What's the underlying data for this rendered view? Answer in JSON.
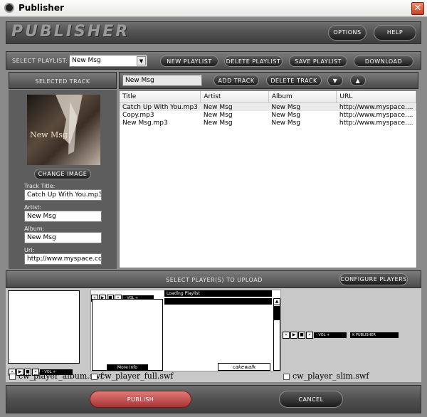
{
  "window": {
    "title": "Publisher",
    "close_symbol": "✕"
  },
  "header": {
    "logo": "PUBLISHER",
    "options_label": "OPTIONS",
    "help_label": "HELP"
  },
  "playlist_bar": {
    "select_label": "SELECT PLAYLIST:",
    "selected_value": "New Msg",
    "new_label": "NEW PLAYLIST",
    "delete_label": "DELETE PLAYLIST",
    "save_label": "SAVE PLAYLIST",
    "download_label": "DOWNLOAD"
  },
  "selected_track": {
    "header": "SELECTED TRACK",
    "cover_text": "New Msg",
    "change_image_label": "CHANGE IMAGE",
    "track_title_label": "Track Title:",
    "track_title_value": "Catch Up With You.mp3",
    "artist_label": "Artist:",
    "artist_value": "New Msg",
    "album_label": "Album:",
    "album_value": "New Msg",
    "url_label": "Url:",
    "url_value": "http://www.myspace.com/"
  },
  "playlist_toolbar": {
    "name_value": "New Msg",
    "add_track_label": "ADD TRACK",
    "delete_track_label": "DELETE TRACK",
    "move_down_symbol": "▼",
    "move_up_symbol": "▲"
  },
  "tracks_table": {
    "columns": [
      "Title",
      "Artist",
      "Album",
      "URL"
    ],
    "rows": [
      [
        "Catch Up With You.mp3",
        "New Msg",
        "New Msg",
        "http://www.myspace...."
      ],
      [
        "Copy.mp3",
        "New Msg",
        "New Msg",
        "http://www.myspace...."
      ],
      [
        "New Msg.mp3",
        "New Msg",
        "New Msg",
        "http://www.myspace...."
      ]
    ]
  },
  "players_section": {
    "header": "SELECT PLAYER(S) TO UPLOAD",
    "configure_label": "CONFIGURE PLAYERS",
    "players": [
      {
        "file": "cw_player_album.swf",
        "vol_label": "- VOL +"
      },
      {
        "file": "cw_player_full.swf",
        "vol_label": "- VOL +",
        "loading_text": "Loading Playlist",
        "more_info": "More Info",
        "brand": "cakewalk"
      },
      {
        "file": "cw_player_slim.swf",
        "vol_label": "- VOL +",
        "brand_text": "K PUBLISHER"
      }
    ]
  },
  "footer": {
    "publish_label": "PUBLISH",
    "cancel_label": "CANCEL"
  },
  "colors": {
    "accent_red": "#b43b3b",
    "frame_gray": "#8a8a8a",
    "dark_panel": "#5d5d5d"
  }
}
